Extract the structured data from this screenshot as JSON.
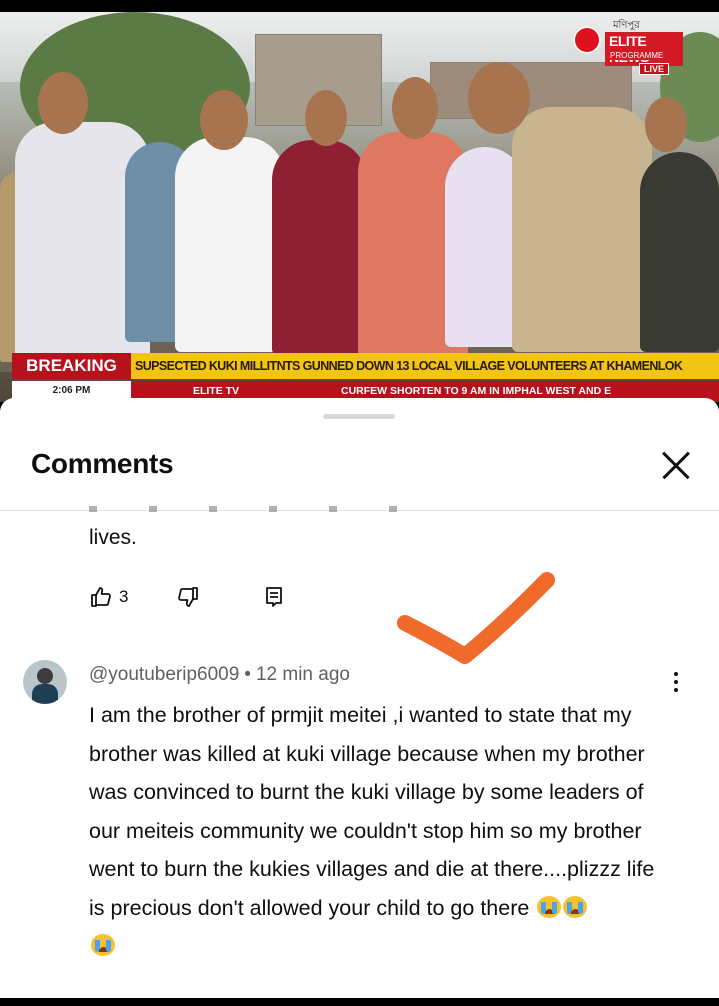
{
  "video": {
    "logo": {
      "small_text": "মণিপুর",
      "brand": "ELITE NEWS",
      "tagline": "PROGRAMME",
      "live": "LIVE"
    },
    "ticker": {
      "breaking": "BREAKING",
      "headline": "SUPSECTED KUKI MILLITNTS GUNNED DOWN 13 LOCAL VILLAGE VOLUNTEERS AT KHAMENLOK",
      "time": "2:06 PM",
      "channel": "ELITE TV",
      "scroll": "CURFEW SHORTEN TO 9 AM IN IMPHAL WEST AND E"
    }
  },
  "comments_sheet": {
    "title": "Comments",
    "previous_comment": {
      "tail_text": "lives.",
      "like_count": "3"
    },
    "comment": {
      "author": "@youtuberip6009",
      "separator": "•",
      "time": "12 min ago",
      "text": "I am the brother of prmjit meitei ,i wanted to state that my brother was killed at kuki village because when my brother was convinced to burnt the kuki village by some leaders of our meiteis community we couldn't stop him so my brother went to burn the kukies villages and die at there....plizzz life is precious don't allowed your child to go there"
    }
  },
  "colors": {
    "accent_orange": "#f06a2b",
    "breaking_red": "#b5121b",
    "headline_yellow": "#f2c413"
  },
  "icons": [
    "close-icon",
    "thumbs-up-icon",
    "thumbs-down-icon",
    "reply-icon",
    "more-vertical-icon",
    "loudly-crying-emoji"
  ]
}
